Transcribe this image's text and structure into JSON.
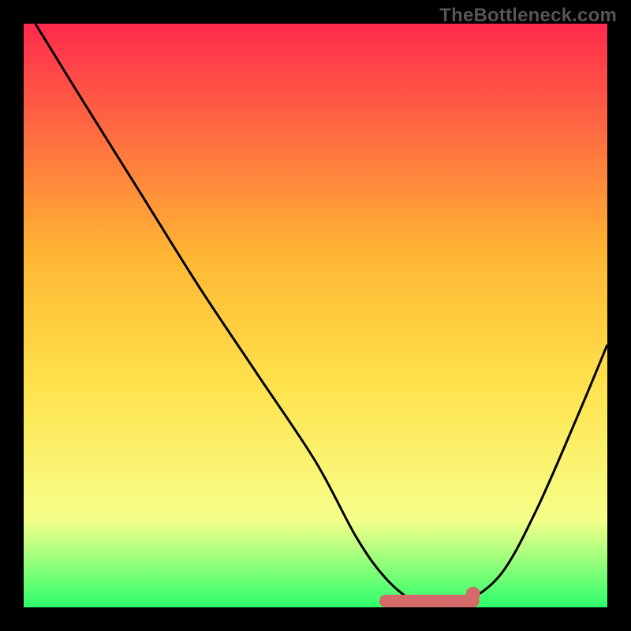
{
  "watermark": "TheBottleneck.com",
  "colors": {
    "frame": "#000000",
    "curve": "#000000",
    "marker_fill": "#d46a6a",
    "marker_stroke": "#c85a5a",
    "gradient_top": "#ff2a4d",
    "gradient_mid_up": "#ffb733",
    "gradient_mid": "#ffe24d",
    "gradient_low": "#f6ff8a",
    "gradient_bottom": "#2eff6b"
  },
  "chart_data": {
    "type": "line",
    "title": "",
    "xlabel": "",
    "ylabel": "",
    "xlim": [
      0,
      100
    ],
    "ylim": [
      0,
      100
    ],
    "x": [
      2,
      10,
      20,
      30,
      40,
      50,
      57,
      62,
      67,
      72,
      76,
      82,
      88,
      95,
      100
    ],
    "values": [
      100,
      87,
      71,
      55,
      40,
      25,
      12,
      5,
      1,
      0,
      1,
      6,
      17,
      33,
      45
    ],
    "optimal_zone": {
      "x_start": 62,
      "x_end": 77,
      "y": 0
    },
    "optimal_marker_end": {
      "x": 77,
      "y": 1.5
    }
  }
}
